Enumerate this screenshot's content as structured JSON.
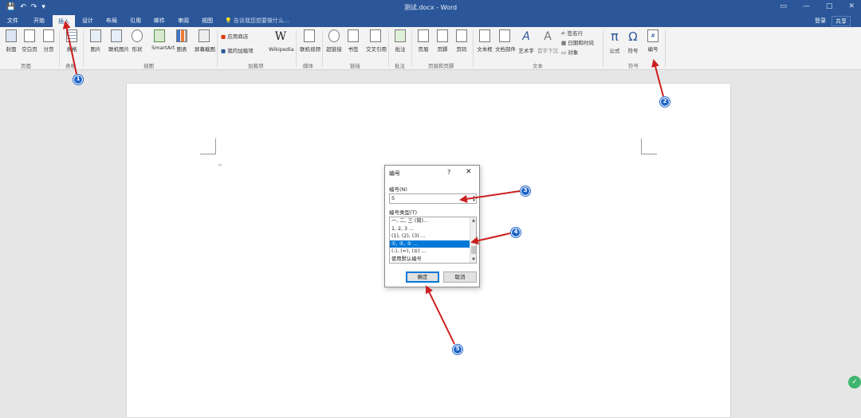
{
  "window": {
    "title": "测试.docx - Word",
    "controls": [
      "▭",
      "—",
      "□",
      "✕"
    ]
  },
  "qat": {
    "save_icon": "💾",
    "undo_icon": "↶",
    "redo_icon": "↷",
    "customize_icon": "▾"
  },
  "tabs": [
    "文件",
    "开始",
    "插入",
    "设计",
    "布局",
    "引用",
    "邮件",
    "审阅",
    "视图"
  ],
  "tell_me": "告诉我您想要做什么...",
  "account": {
    "login": "登录",
    "share": "共享"
  },
  "ribbon": {
    "buttons": [
      "封面",
      "空白页",
      "分页",
      "表格",
      "图片",
      "联机图片",
      "形状",
      "SmartArt",
      "图表",
      "屏幕截图",
      "Wikipedia",
      "联机视频",
      "超链接",
      "书签",
      "交叉引用",
      "批注",
      "页眉",
      "页脚",
      "页码",
      "文本框",
      "文档部件",
      "艺术字",
      "首字下沉",
      "公式",
      "符号",
      "编号"
    ],
    "small_items": [
      "应用商店",
      "我的加载项",
      "签名行",
      "日期和时间",
      "对象"
    ],
    "groups": [
      "页面",
      "表格",
      "插图",
      "加载项",
      "媒体",
      "链接",
      "批注",
      "页眉和页脚",
      "文本",
      "符号"
    ]
  },
  "document": {
    "para_mark": "↵"
  },
  "dialog": {
    "title": "编号",
    "help": "?",
    "close": "✕",
    "number_label": "编号(N)",
    "number_value": "5",
    "type_label": "编号类型(T)",
    "types": [
      "一, 二, 三 (简)...",
      "1, 2, 3 ...",
      "(1), (2), (3) ...",
      "①, ②, ③ ...",
      "(-), (=), (≡) ...",
      "使用默认编号"
    ],
    "selected_index": 3,
    "ok": "确定",
    "cancel": "取消"
  },
  "annotations": {
    "badges": [
      "1",
      "2",
      "3",
      "4",
      "5"
    ],
    "color": "#cc1f1f"
  },
  "colors": {
    "word_blue": "#2b579a",
    "selection": "#0078d7"
  }
}
